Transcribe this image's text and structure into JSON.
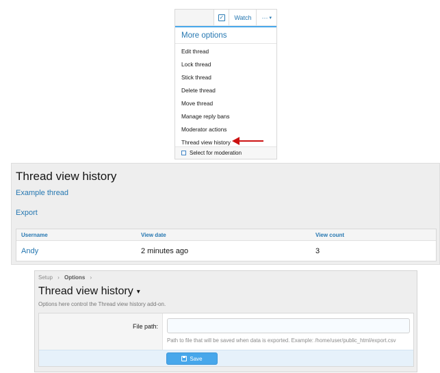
{
  "menu": {
    "toolbar": {
      "watch_label": "Watch",
      "more_label": "···",
      "more_caret": "▾",
      "check_glyph": "✓"
    },
    "heading": "More options",
    "items": [
      "Edit thread",
      "Lock thread",
      "Stick thread",
      "Delete thread",
      "Move thread",
      "Manage reply bans",
      "Moderator actions",
      "Thread view history"
    ],
    "highlighted_item": "Thread view history",
    "footer_checkbox_label": "Select for moderation"
  },
  "history": {
    "title": "Thread view history",
    "thread_link": "Example thread",
    "export_link": "Export",
    "columns": [
      "Username",
      "View date",
      "View count"
    ],
    "rows": [
      {
        "username": "Andy",
        "view_date": "2 minutes ago",
        "view_count": "3"
      }
    ]
  },
  "options": {
    "breadcrumb": [
      "Setup",
      "Options"
    ],
    "breadcrumb_sep": "›",
    "title": "Thread view history",
    "title_caret": "▾",
    "description": "Options here control the Thread view history add-on.",
    "file_path": {
      "label": "File path:",
      "value": "",
      "hint": "Path to file that will be saved when data is exported. Example: /home/user/public_html/export.csv"
    },
    "save_label": "Save"
  },
  "colors": {
    "link": "#2577b1",
    "accent": "#47a7eb",
    "arrow": "#cc1111"
  }
}
